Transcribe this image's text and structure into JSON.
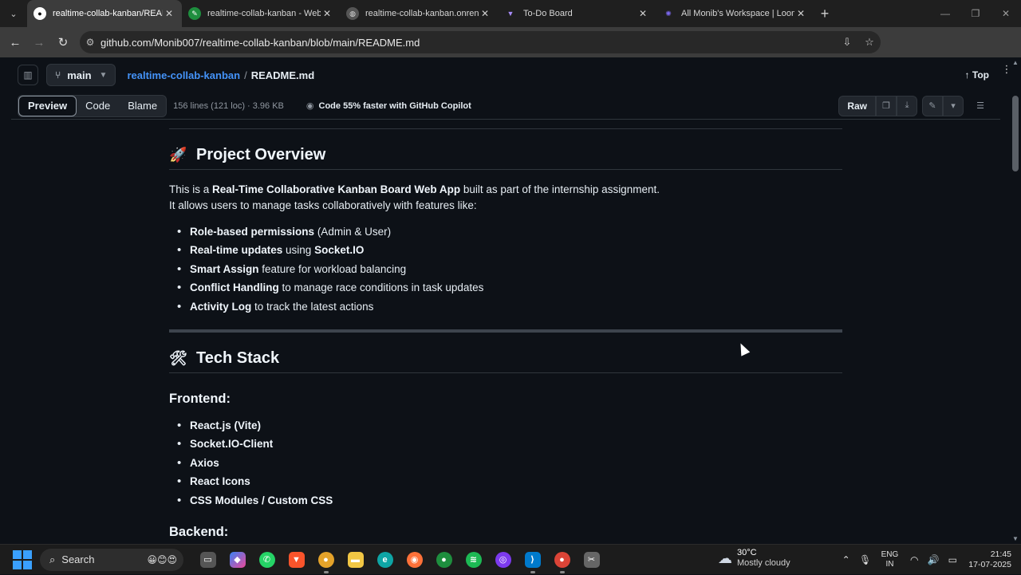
{
  "tabs": [
    {
      "title": "realtime-collab-kanban/README.m",
      "icon": "github-icon",
      "active": true
    },
    {
      "title": "realtime-collab-kanban - Web",
      "icon": "chrome-web-icon",
      "active": false
    },
    {
      "title": "realtime-collab-kanban.onrend",
      "icon": "globe-icon",
      "active": false
    },
    {
      "title": "To-Do Board",
      "icon": "vite-icon",
      "active": false
    },
    {
      "title": "All Monib's Workspace | Loom",
      "icon": "loom-icon",
      "active": false
    }
  ],
  "address": {
    "url": "github.com/Monib007/realtime-collab-kanban/blob/main/README.md"
  },
  "repo_header": {
    "branch": "main",
    "repo": "realtime-collab-kanban",
    "separator": "/",
    "file": "README.md",
    "top_label": "Top"
  },
  "file_toolbar": {
    "views": [
      "Preview",
      "Code",
      "Blame"
    ],
    "active_view": "Preview",
    "meta": "156 lines (121 loc) · 3.96 KB",
    "copilot_promo": "Code 55% faster with GitHub Copilot",
    "raw_label": "Raw"
  },
  "readme": {
    "overview": {
      "emoji": "🚀",
      "heading": "Project Overview",
      "intro_prefix": "This is a ",
      "intro_bold": "Real-Time Collaborative Kanban Board Web App",
      "intro_suffix": " built as part of the internship assignment.",
      "intro_line2": "It allows users to manage tasks collaboratively with features like:",
      "features": [
        {
          "bold": "Role-based permissions",
          "rest": " (Admin & User)",
          "bold2": "",
          "rest2": ""
        },
        {
          "bold": "Real-time updates",
          "rest": " using ",
          "bold2": "Socket.IO",
          "rest2": ""
        },
        {
          "bold": "Smart Assign",
          "rest": " feature for workload balancing",
          "bold2": "",
          "rest2": ""
        },
        {
          "bold": "Conflict Handling",
          "rest": " to manage race conditions in task updates",
          "bold2": "",
          "rest2": ""
        },
        {
          "bold": "Activity Log",
          "rest": " to track the latest actions",
          "bold2": "",
          "rest2": ""
        }
      ]
    },
    "tech": {
      "emoji": "🛠",
      "heading": "Tech Stack",
      "frontend_heading": "Frontend:",
      "frontend": [
        "React.js (Vite)",
        "Socket.IO-Client",
        "Axios",
        "React Icons",
        "CSS Modules / Custom CSS"
      ],
      "backend_heading": "Backend:"
    }
  },
  "taskbar": {
    "search_placeholder": "Search",
    "weather_temp": "30°C",
    "weather_desc": "Mostly cloudy",
    "lang_line1": "ENG",
    "lang_line2": "IN",
    "time": "21:45",
    "date": "17-07-2025"
  },
  "colors": {
    "page_bg": "#0d1117",
    "link": "#4493f8",
    "border": "#30363d",
    "tab_bar": "#1f1f1f",
    "toolbar": "#3c3c3c"
  }
}
